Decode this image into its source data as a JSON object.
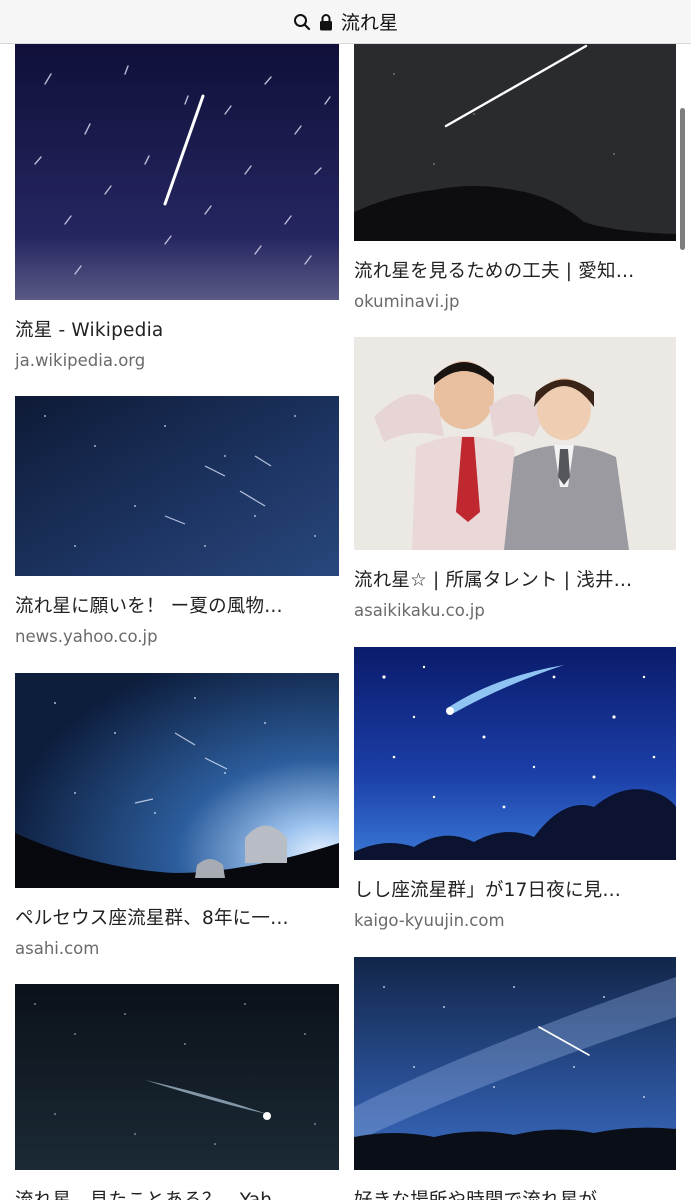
{
  "address_bar": {
    "query": "流れ星",
    "search_icon": "search-icon",
    "lock_icon": "lock-icon"
  },
  "results": [
    {
      "title": "流星 - Wikipedia",
      "source": "ja.wikipedia.org"
    },
    {
      "title": "流れ星を見るための工夫 | 愛知…",
      "source": "okuminavi.jp"
    },
    {
      "title": "流れ星に願いを！ ー夏の風物…",
      "source": "news.yahoo.co.jp"
    },
    {
      "title": "流れ星☆ | 所属タレント | 浅井…",
      "source": "asaikikaku.co.jp"
    },
    {
      "title": "ペルセウス座流星群、8年に一…",
      "source": "asahi.com"
    },
    {
      "title": "しし座流星群」が17日夜に見…",
      "source": "kaigo-kyuujin.com"
    },
    {
      "title": "流れ星、見たことある？ - Yah…",
      "source": ""
    },
    {
      "title": "好きな場所や時間で流れ星が…",
      "source": ""
    }
  ],
  "colors": {
    "bar_bg": "#f6f6f6",
    "title_text": "#222222",
    "source_text": "#6a6a6a"
  }
}
